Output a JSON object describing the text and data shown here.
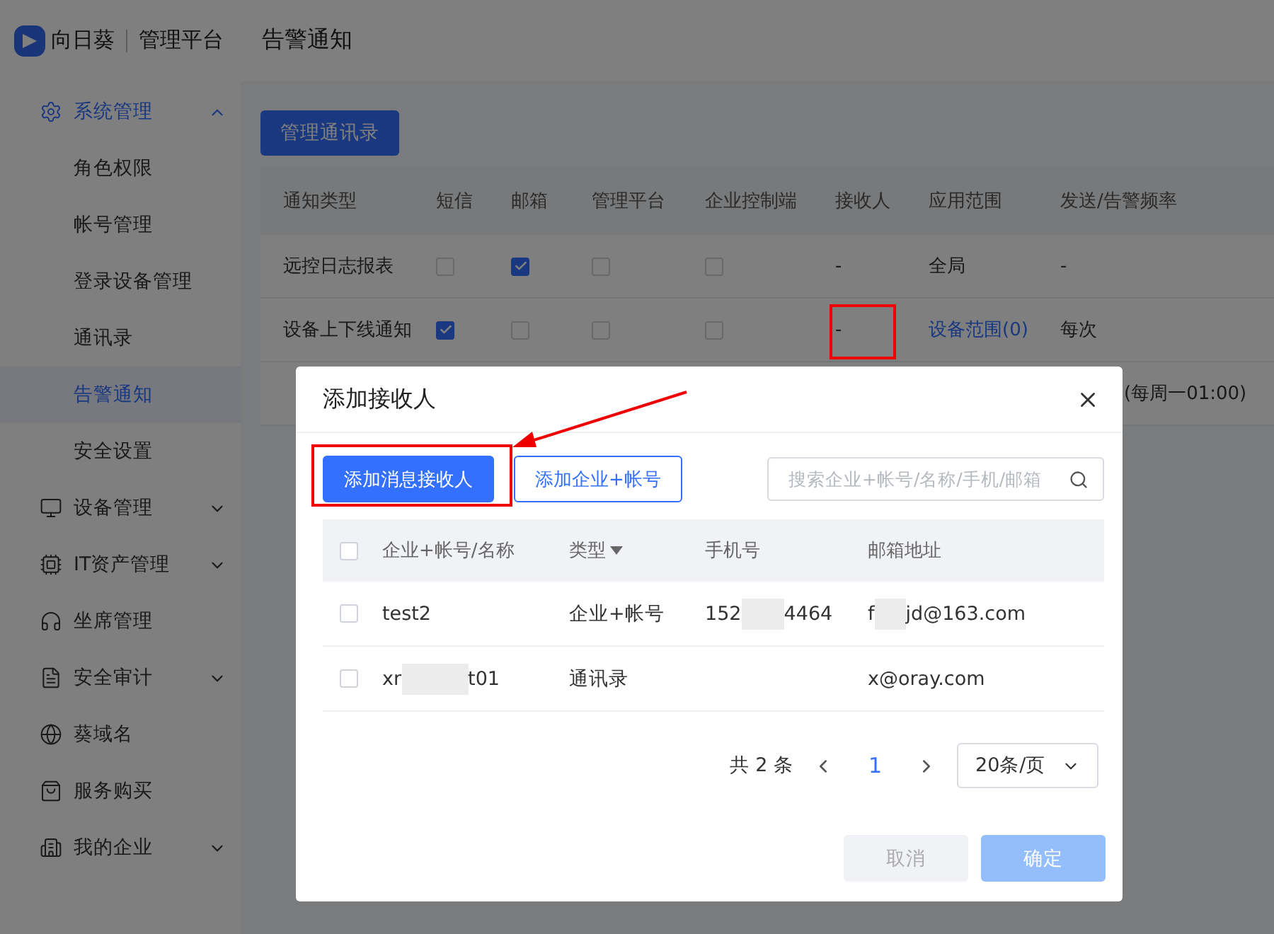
{
  "brand": {
    "name": "向日葵",
    "product": "管理平台"
  },
  "page_title": "告警通知",
  "sidebar": {
    "items": [
      {
        "label": "系统管理",
        "kind": "group",
        "expanded": true,
        "children": [
          {
            "label": "角色权限",
            "selected": false
          },
          {
            "label": "帐号管理",
            "selected": false
          },
          {
            "label": "登录设备管理",
            "selected": false
          },
          {
            "label": "通讯录",
            "selected": false
          },
          {
            "label": "告警通知",
            "selected": true
          },
          {
            "label": "安全设置",
            "selected": false
          }
        ]
      },
      {
        "label": "设备管理",
        "kind": "group",
        "expanded": false
      },
      {
        "label": "IT资产管理",
        "kind": "group",
        "expanded": false
      },
      {
        "label": "坐席管理",
        "kind": "link",
        "expanded": false
      },
      {
        "label": "安全审计",
        "kind": "group",
        "expanded": false
      },
      {
        "label": "葵域名",
        "kind": "link",
        "expanded": false
      },
      {
        "label": "服务购买",
        "kind": "link",
        "expanded": false
      },
      {
        "label": "我的企业",
        "kind": "group",
        "expanded": false
      }
    ]
  },
  "manage_button": "管理通讯录",
  "table": {
    "columns": [
      "通知类型",
      "短信",
      "邮箱",
      "管理平台",
      "企业控制端",
      "接收人",
      "应用范围",
      "发送/告警频率"
    ],
    "rows": [
      {
        "type": "远控日志报表",
        "sms": false,
        "mail": true,
        "platform": false,
        "client": false,
        "receiver": "-",
        "scope": {
          "text": "全局",
          "kind": "text"
        },
        "frequency": "-"
      },
      {
        "type": "设备上下线通知",
        "sms": true,
        "mail": false,
        "platform": false,
        "client": false,
        "receiver": "-",
        "scope": {
          "text": "设备范围(0)",
          "kind": "link"
        },
        "frequency": "每次"
      },
      {
        "frequency": "(每周一01:00)"
      }
    ]
  },
  "dialog": {
    "title": "添加接收人",
    "add_message_button": "添加消息接收人",
    "add_enterprise_button": "添加企业+帐号",
    "search": {
      "placeholder": "搜索企业+帐号/名称/手机/邮箱"
    },
    "columns": [
      "企业+帐号/名称",
      "类型",
      "手机号",
      "邮箱地址"
    ],
    "header_checked": false,
    "rows": [
      {
        "checked": false,
        "name": [
          "test2"
        ],
        "type": "企业+帐号",
        "phone": [
          "152",
          "4464"
        ],
        "email": [
          "f",
          "jd@163.com"
        ]
      },
      {
        "checked": false,
        "name": [
          "xr",
          "t01"
        ],
        "type": "通讯录",
        "phone": [],
        "email": [
          "x@oray.com"
        ]
      }
    ],
    "pagination": {
      "total": "共 2 条",
      "pages": [
        {
          "label": "1",
          "selected": true
        }
      ],
      "page_size": "20条/页"
    },
    "cancel_button": "取消",
    "confirm_button": "确定"
  }
}
